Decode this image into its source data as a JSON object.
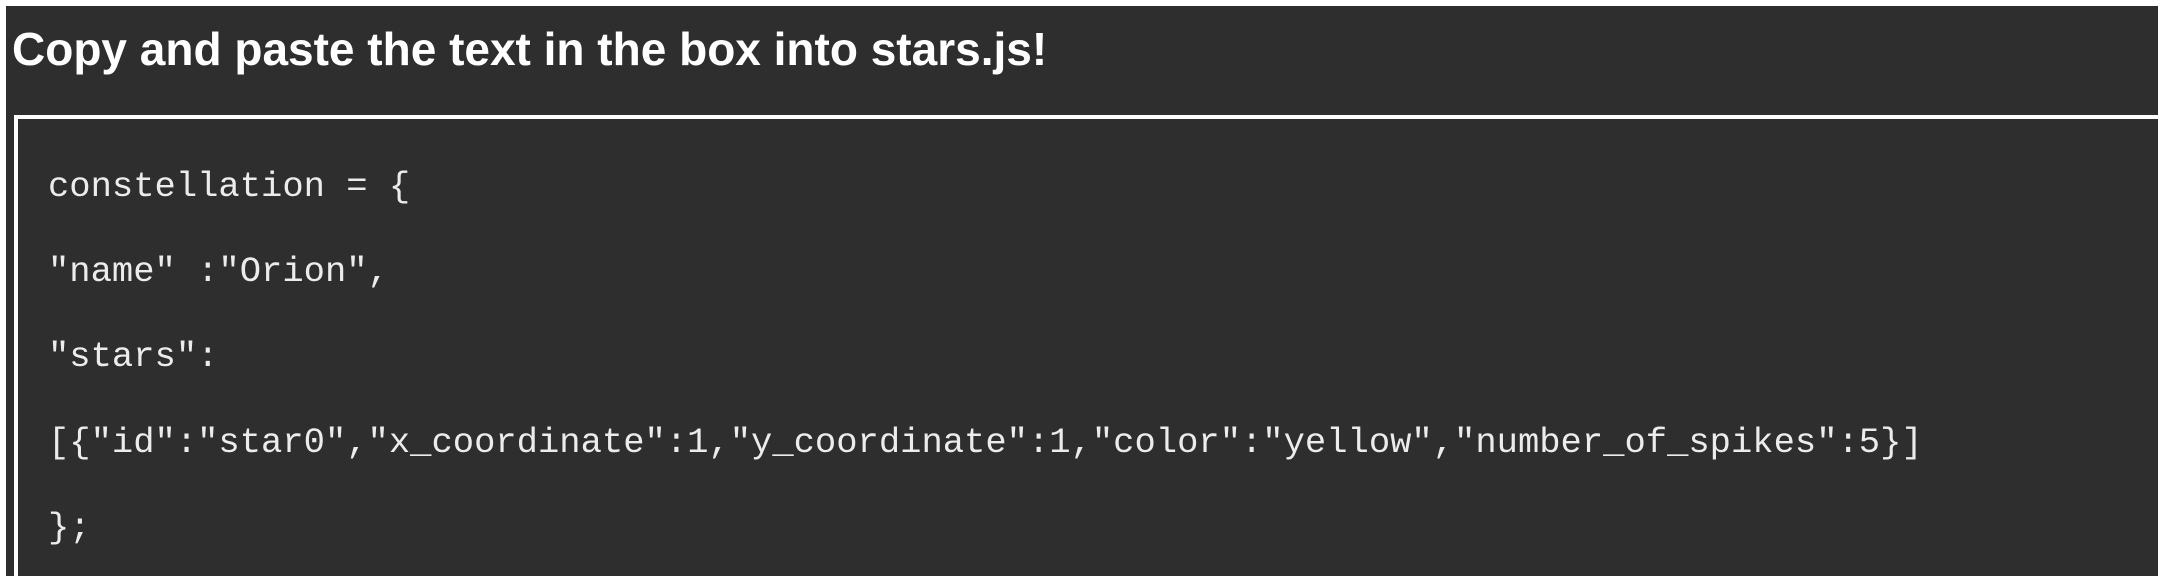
{
  "instruction": {
    "heading": "Copy and paste the text in the box into stars.js!"
  },
  "code": {
    "lines": [
      "constellation = {",
      "\"name\" :\"Orion\",",
      "\"stars\":",
      "[{\"id\":\"star0\",\"x_coordinate\":1,\"y_coordinate\":1,\"color\":\"yellow\",\"number_of_spikes\":5}]",
      "};"
    ]
  },
  "colors": {
    "background": "#2e2e2e",
    "text": "#ffffff",
    "code_text": "#ececec",
    "box_border": "#ffffff"
  }
}
